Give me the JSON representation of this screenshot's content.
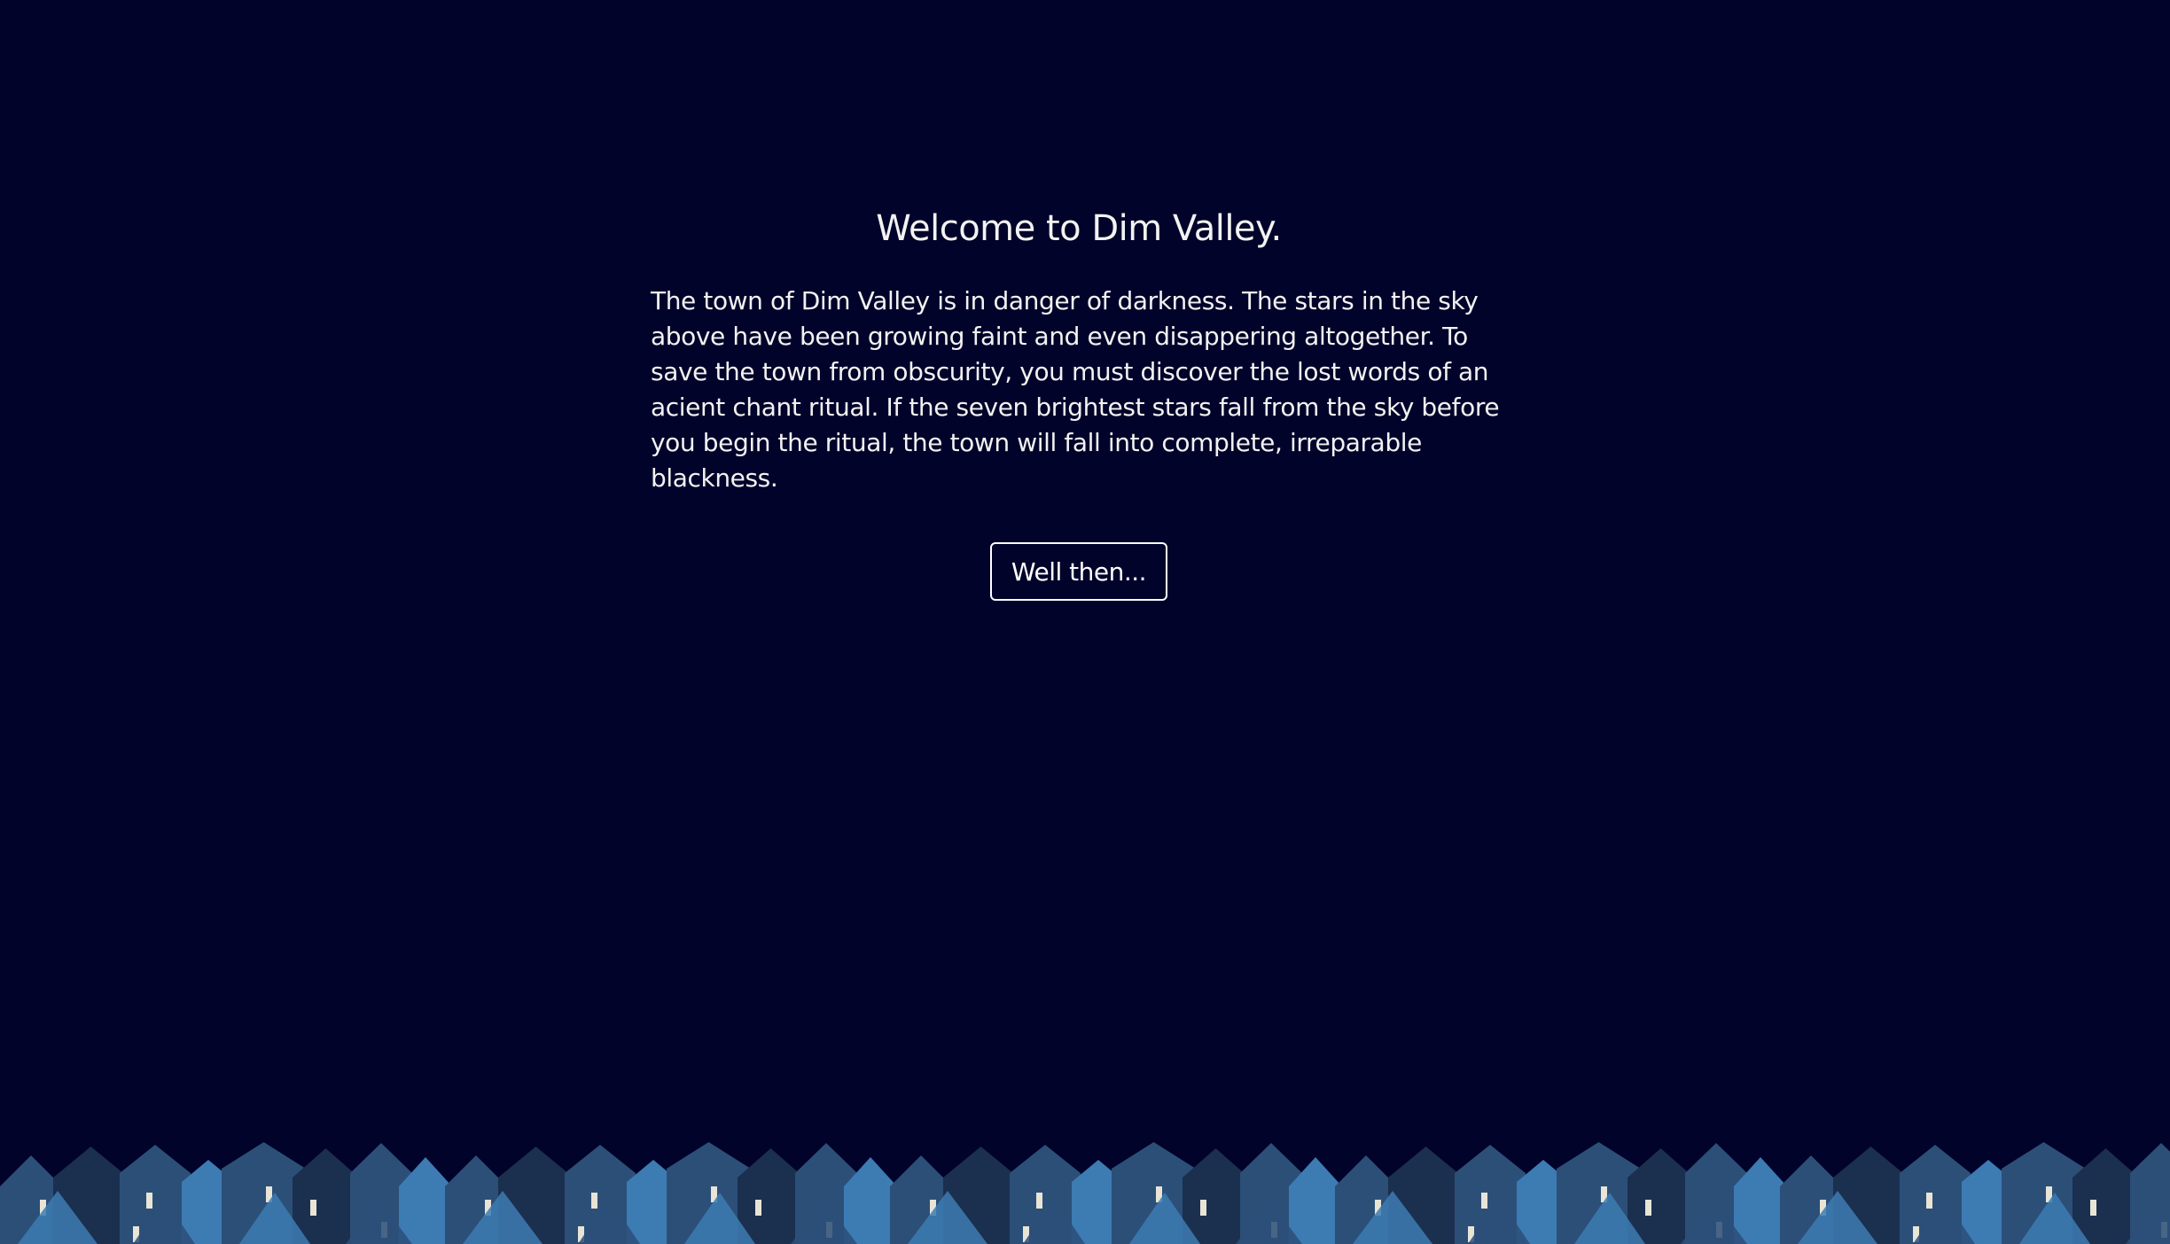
{
  "intro": {
    "title": "Welcome to Dim Valley.",
    "story": "The town of Dim Valley is in danger of darkness. The stars in the sky above have been growing faint and even disappering altogether. To save the town from obscurity, you must discover the lost words of an acient chant ritual. If the seven brightest stars fall from the sky before you begin the ritual, the town will fall into complete, irreparable blackness.",
    "button_label": "Well then..."
  },
  "colors": {
    "background": "#02032a",
    "text": "#f2f2f2",
    "house_dark": "#1b2f4f",
    "house_mid": "#2c4f78",
    "house_light": "#3d7bb3",
    "window": "#e8e4d6"
  }
}
